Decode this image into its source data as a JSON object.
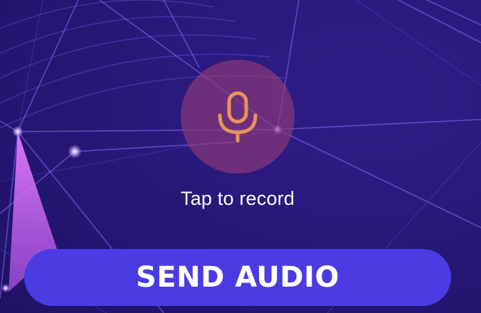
{
  "recorder": {
    "caption": "Tap to record",
    "icon": "microphone-icon",
    "icon_color": "#e8935a",
    "circle_color": "#963c78"
  },
  "actions": {
    "send_label": "SEND AUDIO",
    "send_color": "#4a3ce2"
  }
}
